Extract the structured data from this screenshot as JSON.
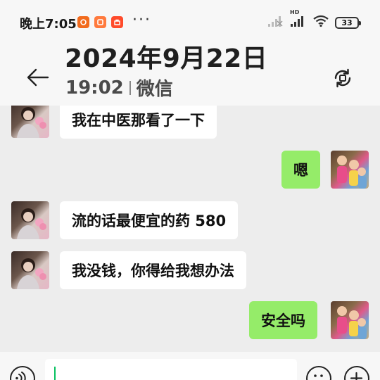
{
  "status_bar": {
    "time": "晚上7:05",
    "dots": "···",
    "battery": "33",
    "network": "HD"
  },
  "header": {
    "date": "2024年9月22日",
    "time": "19:02",
    "app": "微信"
  },
  "messages": [
    {
      "side": "left",
      "text": "我在中医那看了一下"
    },
    {
      "side": "right",
      "text": "嗯"
    },
    {
      "side": "left",
      "text": "流的话最便宜的药 580"
    },
    {
      "side": "left",
      "text": "我没钱，你得给我想办法"
    },
    {
      "side": "right",
      "text": "安全吗"
    }
  ],
  "input": {
    "value": ""
  },
  "colors": {
    "self_bubble": "#95ec69",
    "other_bubble": "#ffffff",
    "chat_bg": "#ededed",
    "caret": "#07c160"
  }
}
